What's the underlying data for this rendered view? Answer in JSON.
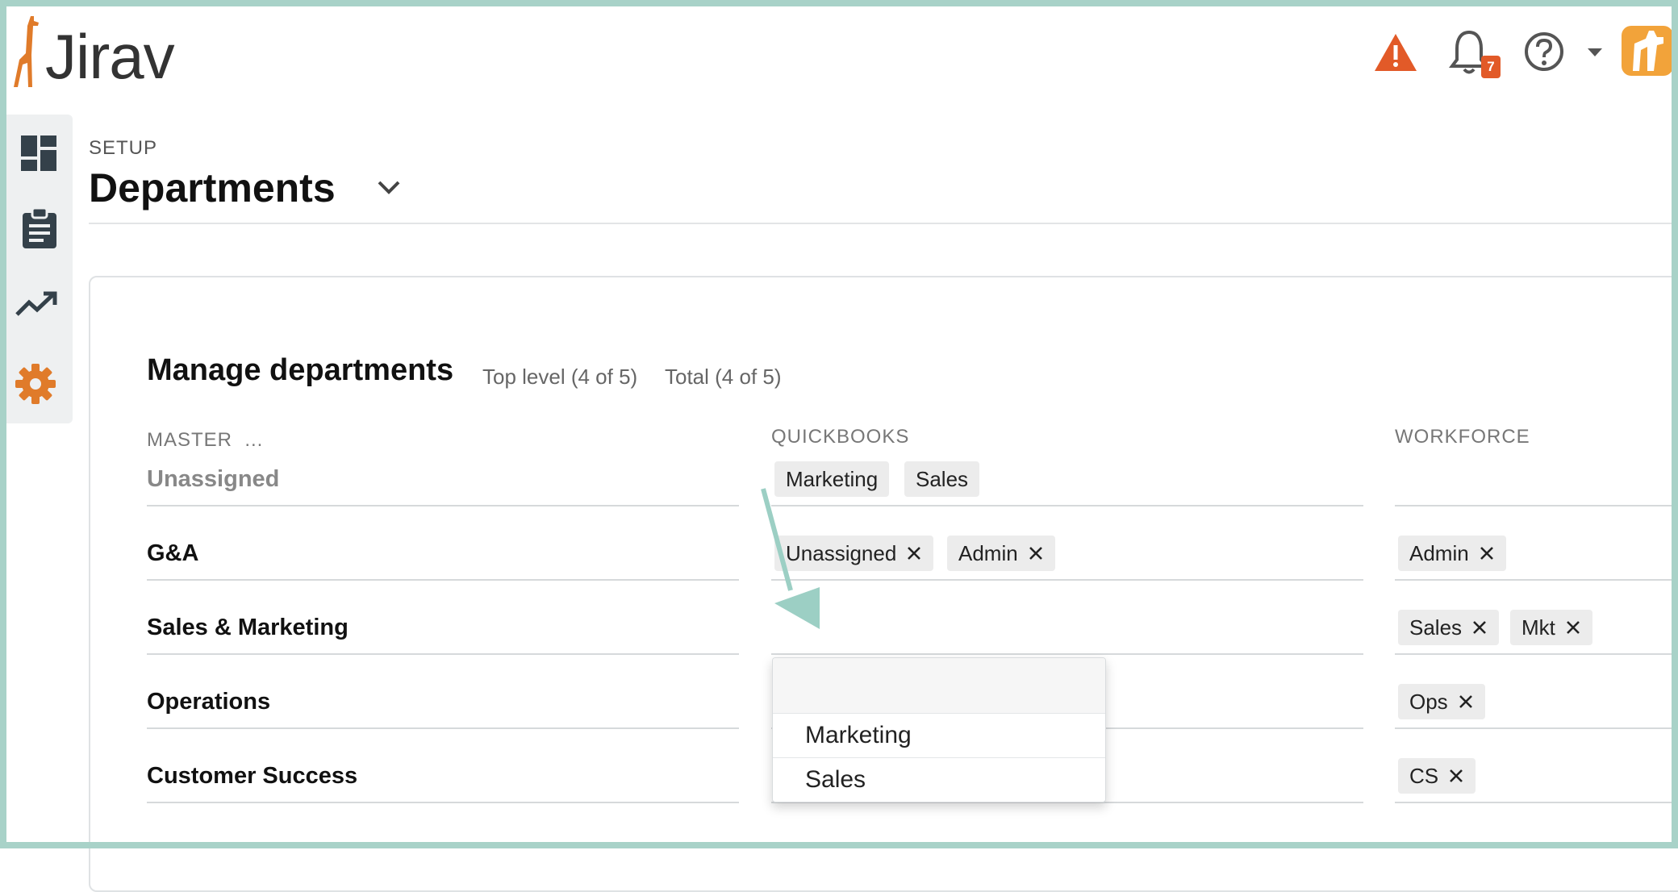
{
  "app": {
    "logo_text": "Jirav",
    "notification_count": "7"
  },
  "header_icons": [
    "warning-icon",
    "bell-icon",
    "help-icon",
    "caret-down-icon",
    "user-avatar"
  ],
  "sidebar": {
    "items": [
      "dashboard-icon",
      "clipboard-icon",
      "trend-icon",
      "settings-icon"
    ]
  },
  "page": {
    "eyebrow": "SETUP",
    "title": "Departments"
  },
  "manage": {
    "title": "Manage departments",
    "top_level": "Top level (4 of 5)",
    "total": "Total (4 of 5)"
  },
  "columns": {
    "master": "MASTER  ...",
    "quickbooks": "QUICKBOOKS",
    "workforce": "WORKFORCE"
  },
  "rows": [
    {
      "label": "Unassigned",
      "quickbooks": [
        "Marketing",
        "Sales"
      ],
      "workforce": []
    },
    {
      "label": "G&A",
      "quickbooks": [
        "Unassigned",
        "Admin"
      ],
      "workforce": [
        "Admin"
      ]
    },
    {
      "label": "Sales & Marketing",
      "quickbooks": [],
      "workforce": [
        "Sales",
        "Mkt"
      ]
    },
    {
      "label": "Operations",
      "quickbooks": [],
      "workforce": [
        "Ops"
      ]
    },
    {
      "label": "Customer Success",
      "quickbooks": [],
      "workforce": [
        "CS"
      ]
    }
  ],
  "dropdown": {
    "search_value": "",
    "options": [
      "Marketing",
      "Sales"
    ]
  },
  "colors": {
    "accent_orange": "#e07b2a",
    "warning_red": "#e25a28",
    "frame_teal": "#a8d2c8",
    "arrow_teal": "#9ccfc4"
  }
}
